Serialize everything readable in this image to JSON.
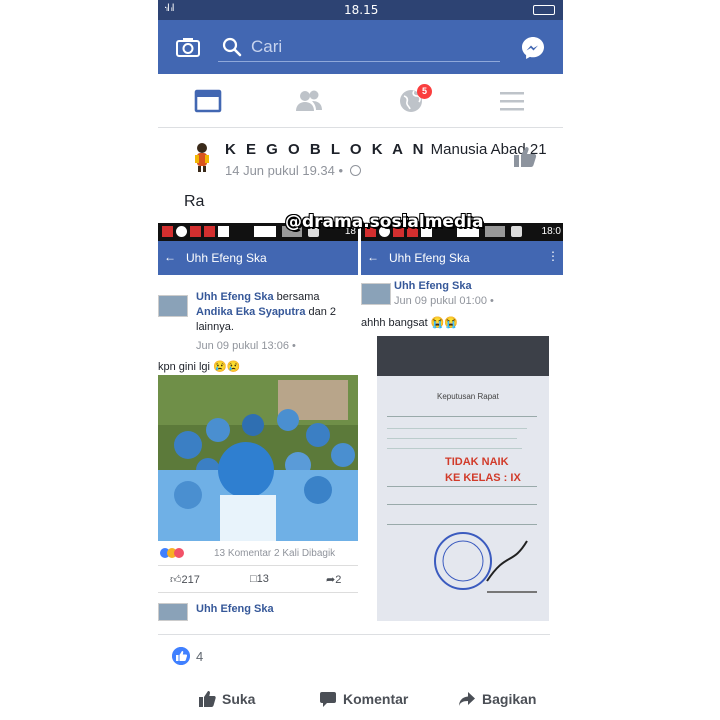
{
  "status_bar": {
    "signal": "‧ᵢl ᵢl",
    "time": "18.15"
  },
  "search": {
    "placeholder": "Cari"
  },
  "tabs": {
    "notification_count": "5"
  },
  "post": {
    "page_name_spaced": "K E G O B L O K A N",
    "page_name_rest": " Manusia Abad 21",
    "time": "14 Jun pukul 19.34 •",
    "text": "Ra",
    "like_count": "4"
  },
  "left_shot": {
    "status_time": "18",
    "header_title": "Uhh Efeng Ska",
    "author": "Uhh Efeng Ska",
    "with_word": " bersama ",
    "tagged": "Andika Eka Syaputra",
    "and_others_word": " dan ",
    "others": "2 lainnya.",
    "time": "Jun 09 pukul 13:06 •",
    "caption": "kpn gini lgi 😢😢",
    "reaction_stats": "13 Komentar  2 Kali Dibagik",
    "likes": "217",
    "comments": "13",
    "shares": "2",
    "next_author": "Uhh Efeng Ska"
  },
  "right_shot": {
    "status_time": "18:0",
    "header_title": "Uhh Efeng Ska",
    "author": "Uhh Efeng Ska",
    "time": "Jun 09 pukul 01:00 •",
    "caption": "ahhh bangsat 😭😭",
    "doc_heading": "Keputusan Rapat",
    "doc_result_1": "TIDAK NAIK",
    "doc_result_2": "KE KELAS : IX"
  },
  "watermark": "@drama.sosialmedia",
  "actions": {
    "like": "Suka",
    "comment": "Komentar",
    "share": "Bagikan"
  },
  "colors": {
    "facebook_blue": "#4267b2",
    "status_bar": "#2d4373",
    "badge_red": "#fa3e3e",
    "like_blue": "#4080ff"
  }
}
